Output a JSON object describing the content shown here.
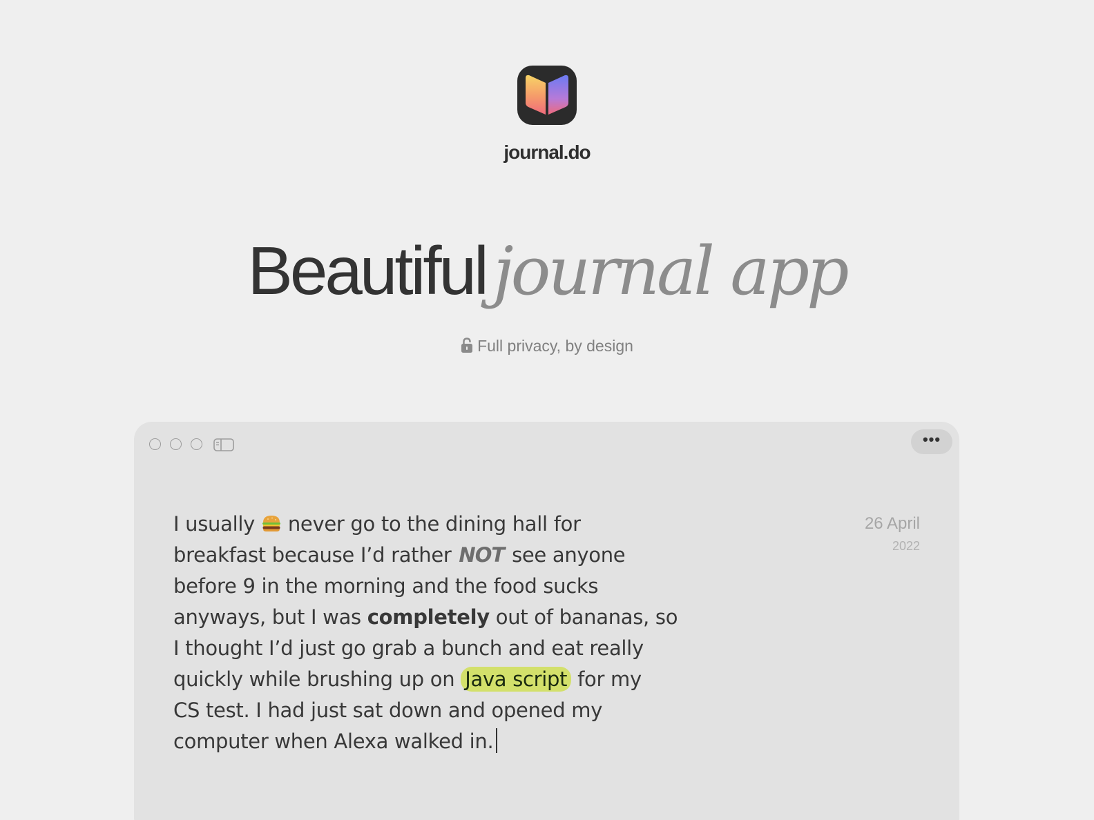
{
  "brand": {
    "name": "journal.do",
    "icon": "open-book-logo-icon"
  },
  "hero": {
    "headline_plain": "Beautiful",
    "headline_italic": "journal app",
    "tagline": "Full privacy, by design",
    "tagline_icon": "lock-icon"
  },
  "window": {
    "controls": [
      "close-button",
      "minimize-button",
      "zoom-button"
    ],
    "sidebar_toggle_icon": "sidebar-toggle-icon",
    "more_label": "•••",
    "date": {
      "day_month": "26 April",
      "year": "2022"
    },
    "entry": {
      "line1_a": "I usually",
      "line1_emoji": "burger-emoji",
      "line1_b": "never go to the dining hall for",
      "line2_a": "breakfast because I’d rather",
      "line2_scribble": "NOT",
      "line2_b": "see anyone",
      "line3": "before 9 in the morning and the food sucks",
      "line4_a": "anyways, but I was",
      "line4_bold": "completely",
      "line4_b": "out of bananas, so",
      "line5": "I thought I’d just go grab a bunch and eat really",
      "line6_a": "quickly while brushing up on",
      "line6_highlight": "Java script",
      "line6_b": "for my",
      "line7": "CS test. I had just sat down and opened my",
      "line8": "computer when Alexa walked in."
    }
  },
  "colors": {
    "background": "#efefef",
    "window": "#e2e2e2",
    "highlight": "#d3e06b",
    "text": "#383838"
  }
}
